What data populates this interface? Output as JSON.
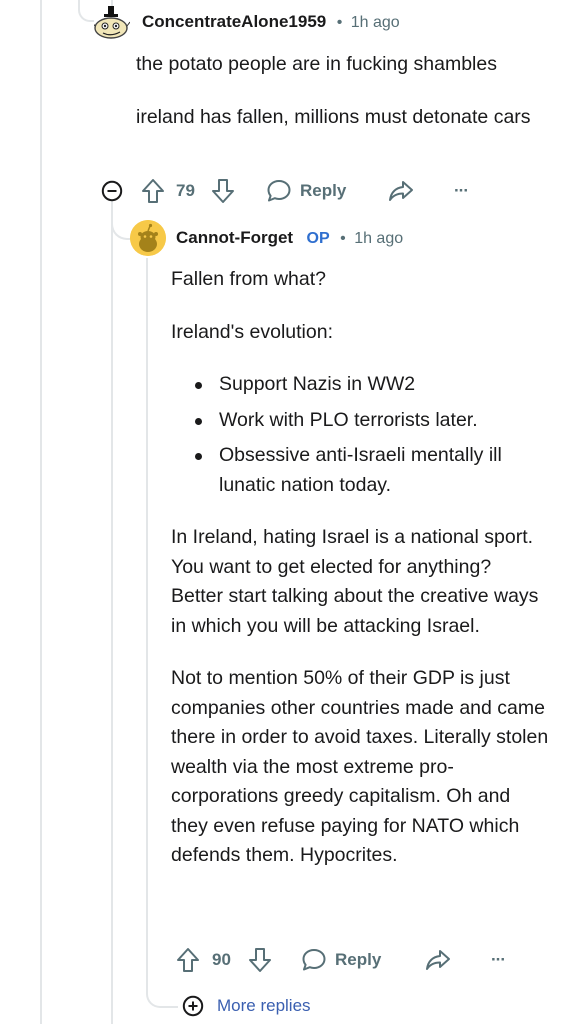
{
  "comment1": {
    "author": "ConcentrateAlone1959",
    "separator": "•",
    "time": "1h ago",
    "paragraphs": [
      "the potato people are in fucking shambles",
      "ireland has fallen, millions must detonate cars"
    ],
    "votes": "79",
    "reply_label": "Reply",
    "more_label": "···"
  },
  "comment2": {
    "author": "Cannot-Forget",
    "op_badge": "OP",
    "separator": "•",
    "time": "1h ago",
    "para1": "Fallen from what?",
    "para2": "Ireland's evolution:",
    "bullets": [
      "Support Nazis in WW2",
      "Work with PLO terrorists later.",
      "Obsessive anti-Israeli mentally ill lunatic nation today."
    ],
    "para3": "In Ireland, hating Israel is a national sport. You want to get elected for anything? Better start talking about the creative ways in which you will be attacking Israel.",
    "para4": "Not to mention 50% of their GDP is just companies other countries made and came there in order to avoid taxes. Literally stolen wealth via the most extreme pro-corporations greedy capitalism. Oh and they even refuse paying for NATO which defends them. Hypocrites.",
    "votes": "90",
    "reply_label": "Reply",
    "more_label": "···"
  },
  "more_replies_label": "More replies",
  "colors": {
    "meta": "#576f76",
    "op": "#2f6fcf",
    "thread": "#e3e6e8"
  }
}
